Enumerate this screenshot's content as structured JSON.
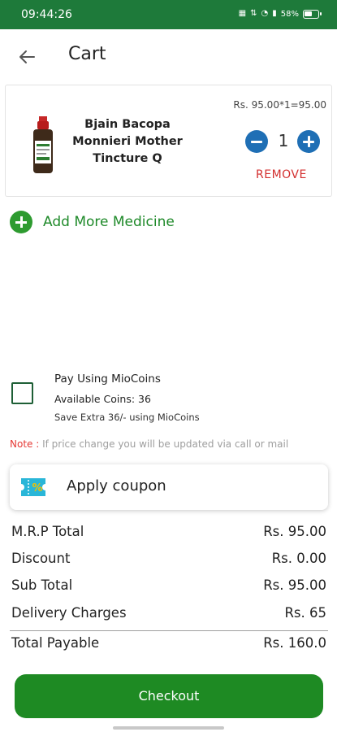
{
  "status_bar": {
    "time": "09:44:26",
    "battery_text": "58%",
    "battery_level": 0.58,
    "icons": [
      "qr-icon",
      "data-icon",
      "wifi-icon",
      "signal-icon",
      "battery-icon"
    ]
  },
  "header": {
    "title": "Cart",
    "back_icon": "back-arrow-icon"
  },
  "cart": {
    "items": [
      {
        "name": "Bjain Bacopa Monnieri Mother Tincture Q",
        "price_line": "Rs. 95.00*1=95.00",
        "quantity": "1",
        "remove_label": "REMOVE"
      }
    ]
  },
  "add_more": {
    "label": "Add More Medicine"
  },
  "miocoins": {
    "title": "Pay Using MioCoins",
    "available": "Available Coins: 36",
    "save_text": "Save Extra 36/- using MioCoins",
    "checked": false
  },
  "note": {
    "label": "Note :",
    "text": " If price change you will be updated via call or mail"
  },
  "coupon": {
    "label": "Apply coupon"
  },
  "summary": {
    "rows": [
      {
        "label": "M.R.P Total",
        "value": "Rs. 95.00"
      },
      {
        "label": "Discount",
        "value": "Rs. 0.00"
      },
      {
        "label": "Sub Total",
        "value": "Rs. 95.00"
      },
      {
        "label": "Delivery Charges",
        "value": "Rs. 65"
      },
      {
        "label": "Total Payable",
        "value": "Rs. 160.0"
      }
    ]
  },
  "checkout": {
    "label": "Checkout"
  },
  "colors": {
    "status_bar": "#1e7a3a",
    "accent_green": "#1e8a23",
    "qty_blue": "#1f6fb5",
    "remove_red": "#d32f2f"
  }
}
